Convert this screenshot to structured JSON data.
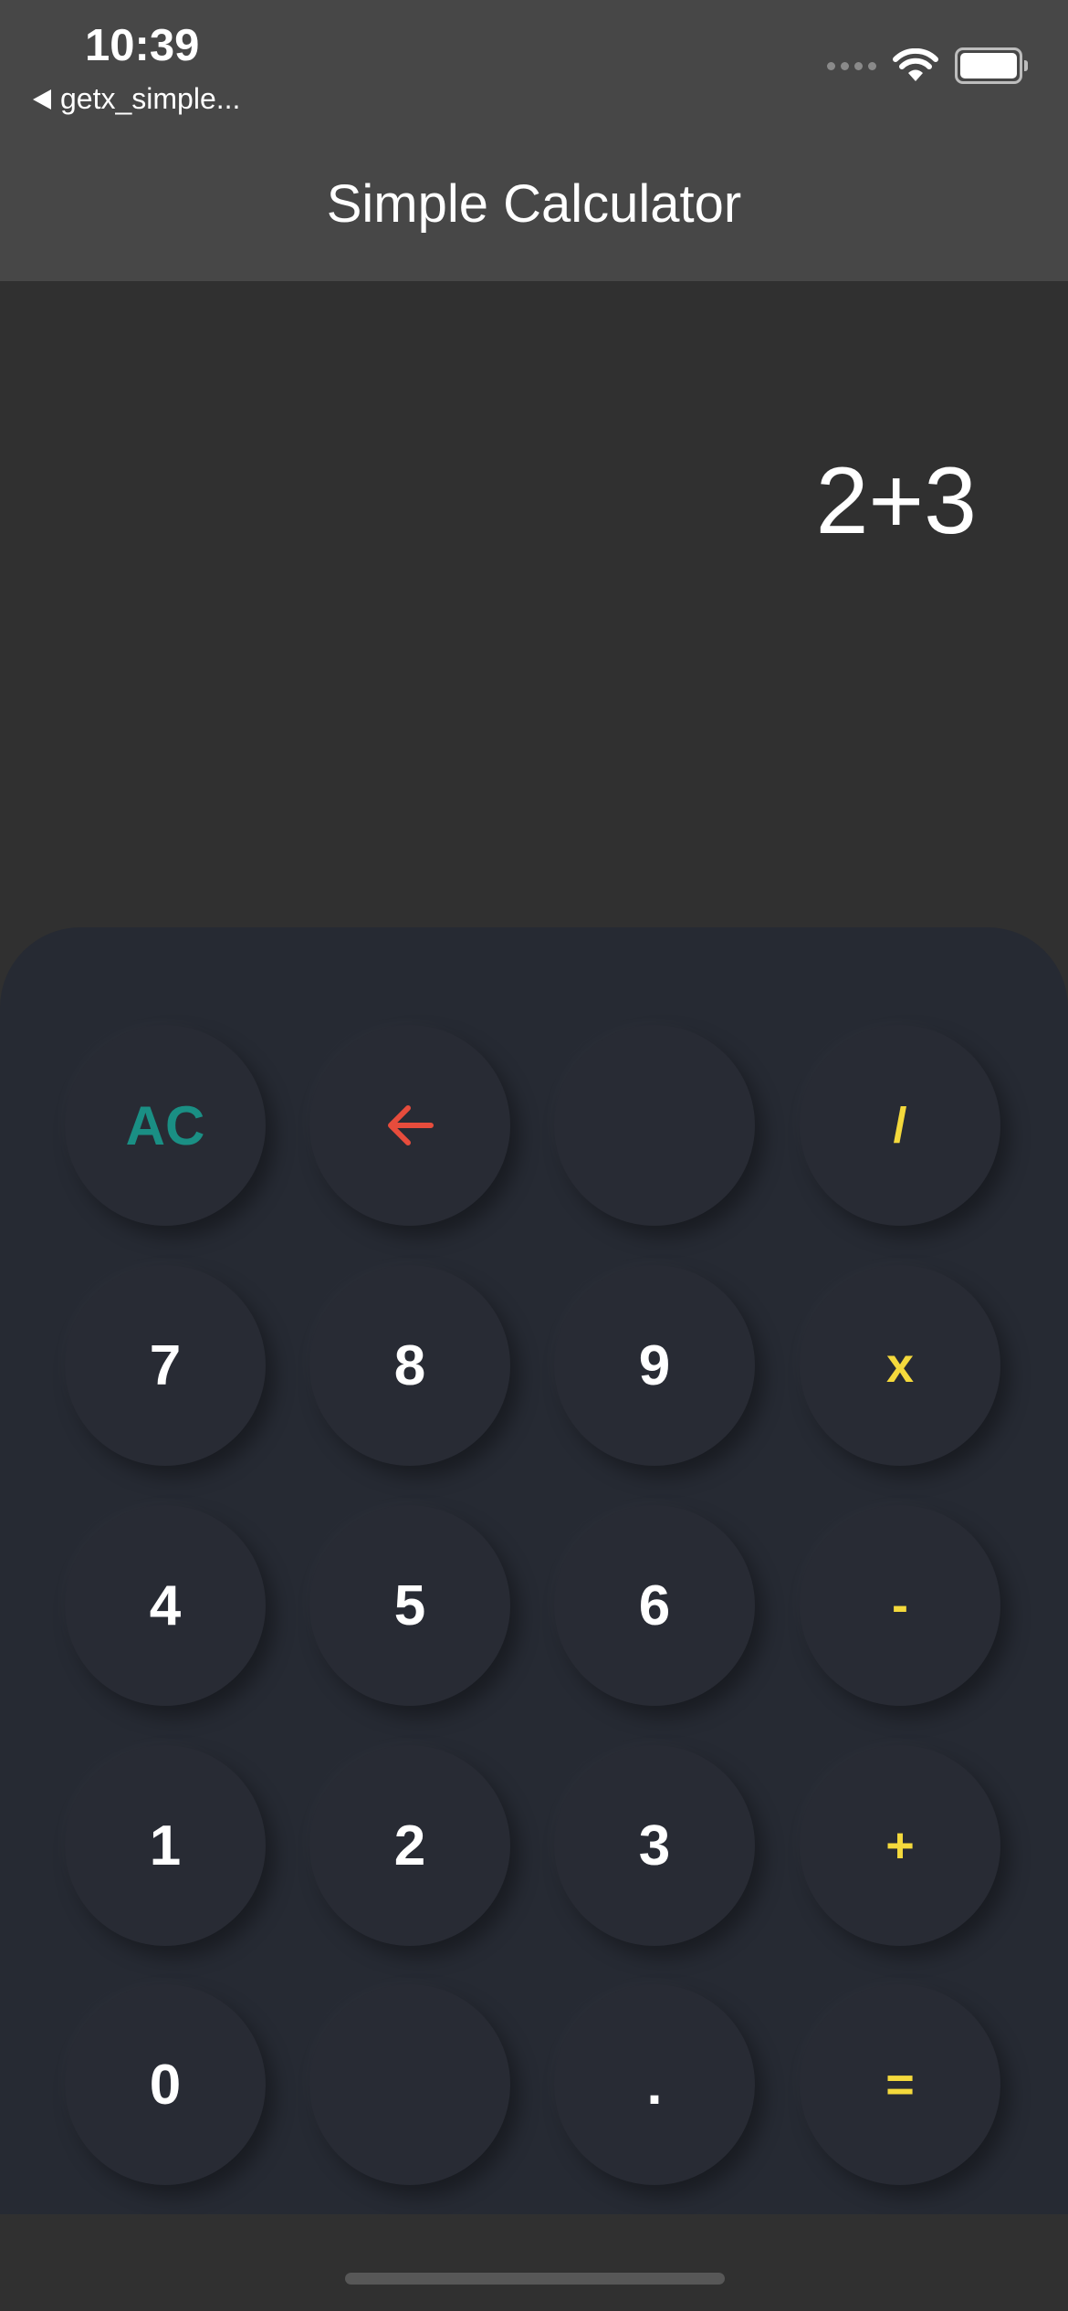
{
  "status_bar": {
    "time": "10:39",
    "back_app_label": "getx_simple..."
  },
  "app_bar": {
    "title": "Simple Calculator"
  },
  "display": {
    "expression": "2+3"
  },
  "keypad": {
    "rows": [
      [
        {
          "label": "AC",
          "name": "clear-button",
          "kind": "ac"
        },
        {
          "label": "",
          "name": "backspace-button",
          "kind": "back",
          "icon": "arrow-left-icon"
        },
        {
          "label": "",
          "name": "empty-button-1",
          "kind": "num"
        },
        {
          "label": "/",
          "name": "divide-button",
          "kind": "op"
        }
      ],
      [
        {
          "label": "7",
          "name": "digit-7-button",
          "kind": "num"
        },
        {
          "label": "8",
          "name": "digit-8-button",
          "kind": "num"
        },
        {
          "label": "9",
          "name": "digit-9-button",
          "kind": "num"
        },
        {
          "label": "x",
          "name": "multiply-button",
          "kind": "op"
        }
      ],
      [
        {
          "label": "4",
          "name": "digit-4-button",
          "kind": "num"
        },
        {
          "label": "5",
          "name": "digit-5-button",
          "kind": "num"
        },
        {
          "label": "6",
          "name": "digit-6-button",
          "kind": "num"
        },
        {
          "label": "-",
          "name": "subtract-button",
          "kind": "op"
        }
      ],
      [
        {
          "label": "1",
          "name": "digit-1-button",
          "kind": "num"
        },
        {
          "label": "2",
          "name": "digit-2-button",
          "kind": "num"
        },
        {
          "label": "3",
          "name": "digit-3-button",
          "kind": "num"
        },
        {
          "label": "+",
          "name": "add-button",
          "kind": "op"
        }
      ],
      [
        {
          "label": "0",
          "name": "digit-0-button",
          "kind": "num"
        },
        {
          "label": "",
          "name": "empty-button-2",
          "kind": "num"
        },
        {
          "label": ".",
          "name": "decimal-button",
          "kind": "num"
        },
        {
          "label": "=",
          "name": "equals-button",
          "kind": "op"
        }
      ]
    ]
  },
  "colors": {
    "app_bar": "#474747",
    "background": "#303030",
    "keypad": "#262a33",
    "operator": "#f4d93c",
    "clear": "#1a8f84",
    "backspace": "#e74c3c"
  }
}
